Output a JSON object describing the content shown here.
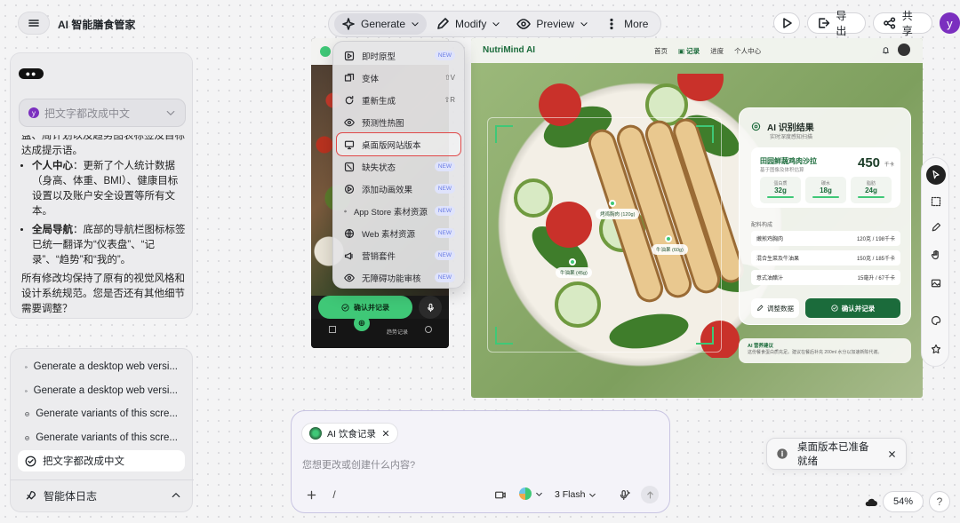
{
  "header": {
    "app_title": "AI 智能膳食管家",
    "toolbar": [
      {
        "label": "Generate",
        "icon": "sparkle-icon"
      },
      {
        "label": "Modify",
        "icon": "pen-icon"
      },
      {
        "label": "Preview",
        "icon": "eye-icon"
      },
      {
        "label": "More",
        "icon": "more-vertical-icon"
      }
    ],
    "export_label": "导出",
    "share_label": "共享",
    "avatar_letter": "y"
  },
  "chat": {
    "selected_prompt": "把文字都改成中文",
    "prompt_avatar": "y",
    "overflow_text": "盘、周计划以及趋势图表标签及目标达成提示语。",
    "bullets": [
      {
        "title": "个人中心",
        "text": "：更新了个人统计数据（身高、体重、BMI）、健康目标设置以及账户安全设置等所有文本。"
      },
      {
        "title": "全局导航",
        "text": "：底部的导航栏图标标签已统一翻译为“仪表盘”、“记录”、“趋势”和“我的”。"
      }
    ],
    "closing": "所有修改均保持了原有的视觉风格和设计系统规范。您是否还有其他细节需要调整？"
  },
  "history": {
    "items": [
      "Generate a desktop web versi...",
      "Generate a desktop web versi...",
      "Generate variants of this scre...",
      "Generate variants of this scre...",
      "把文字都改成中文"
    ],
    "agent_log_label": "智能体日志"
  },
  "generate_menu": {
    "badge_label": "NEW",
    "items": [
      {
        "label": "即时原型",
        "badge": true,
        "kbd": ""
      },
      {
        "label": "变体",
        "badge": false,
        "kbd": "⇧V"
      },
      {
        "label": "重新生成",
        "badge": false,
        "kbd": "⇧R"
      },
      {
        "label": "预测性热图",
        "badge": false,
        "kbd": ""
      },
      {
        "label": "桌面版网站版本",
        "badge": false,
        "kbd": ""
      },
      {
        "label": "缺失状态",
        "badge": true,
        "kbd": ""
      },
      {
        "label": "添加动画效果",
        "badge": true,
        "kbd": ""
      },
      {
        "label": "App Store 素材资源",
        "badge": true,
        "kbd": ""
      },
      {
        "label": "Web 素材资源",
        "badge": true,
        "kbd": ""
      },
      {
        "label": "营销套件",
        "badge": true,
        "kbd": ""
      },
      {
        "label": "无障碍功能审核",
        "badge": true,
        "kbd": ""
      }
    ]
  },
  "mobile_preview": {
    "confirm_label": "确认并记录",
    "nav_label": "趋势记录"
  },
  "desktop_preview": {
    "brand": "NutriMind AI",
    "nav_links": [
      "首页",
      "记录",
      "进度",
      "个人中心"
    ],
    "result_title": "AI 识别结果",
    "result_subtitle": "实时深度感知扫描",
    "food_name": "田园鲜蔬鸡肉沙拉",
    "food_sub": "基于图像及体积估算",
    "kcal_value": "450",
    "kcal_unit": "千卡",
    "macros": [
      {
        "name": "蛋白质",
        "value": "32g"
      },
      {
        "name": "碳水",
        "value": "18g"
      },
      {
        "name": "脂肪",
        "value": "24g"
      }
    ],
    "ingredients_title": "配料构成",
    "ingredients": [
      {
        "name": "嫩煎鸡胸肉",
        "amount": "120克 / 198千卡"
      },
      {
        "name": "混合生菜及牛油果",
        "amount": "150克 / 185千卡"
      },
      {
        "name": "意式油醋汁",
        "amount": "15毫升 / 67千卡"
      }
    ],
    "adjust_label": "调整数据",
    "record_label": "确认并记录",
    "advice_title": "AI 营养建议",
    "advice_text": "这份餐食蛋白质充足。建议在餐后补充 200ml 水分以加速新陈代谢。",
    "tags": [
      "烤鸡胸肉 (120g)",
      "牛油果 (60g)",
      "牛油果 (45g)"
    ]
  },
  "composer": {
    "chip_label": "AI 饮食记录",
    "placeholder": "您想更改或创建什么内容?",
    "slash": "/",
    "model_label": "3 Flash"
  },
  "toast": {
    "message": "桌面版本已准备就绪"
  },
  "footer": {
    "zoom": "54%",
    "help": "?"
  },
  "colors": {
    "accent_green": "#3fc877",
    "brand_green": "#1b6b3b",
    "highlight_red": "#e04848",
    "avatar_purple": "#7b2fbf"
  }
}
